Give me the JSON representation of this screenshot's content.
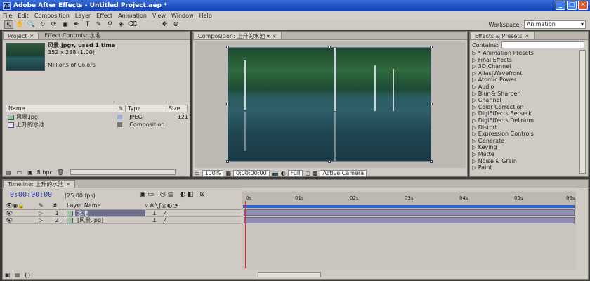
{
  "window": {
    "title": "Adobe After Effects - Untitled Project.aep *",
    "app_icon": "Ae",
    "controls": [
      "_",
      "□",
      "✕"
    ]
  },
  "menu": [
    "File",
    "Edit",
    "Composition",
    "Layer",
    "Effect",
    "Animation",
    "View",
    "Window",
    "Help"
  ],
  "toolbar": {
    "tools": [
      "↖",
      "✋",
      "🔍",
      "↻",
      "⟳",
      "▣",
      "✒",
      "T",
      "✎",
      "⚲",
      "◈",
      "⌫",
      "✥",
      "⊕"
    ],
    "workspace_label": "Workspace:",
    "workspace_value": "Animation"
  },
  "project": {
    "tabs": [
      "Project",
      "Effect Controls: 水池"
    ],
    "item_name": "风景.jpg▾, used 1 time",
    "item_dims": "352 x 288 (1.00)",
    "item_colors": "Millions of Colors",
    "columns": {
      "name": "Name",
      "type": "Type",
      "size": "Size"
    },
    "rows": [
      {
        "name": "风景.jpg",
        "type": "JPEG",
        "size": "121"
      },
      {
        "name": "上升的水池",
        "type": "Composition",
        "size": ""
      }
    ],
    "bpc": "8 bpc"
  },
  "composition": {
    "tab": "Composition: 上升的水池",
    "zoom": "100%",
    "timecode": "0:00:00:00",
    "resolution": "Full",
    "camera": "Active Camera"
  },
  "effects": {
    "tab": "Effects & Presets",
    "contains_label": "Contains:",
    "items": [
      "▷ * Animation Presets",
      "▷ Final Effects",
      "▷ 3D Channel",
      "▷ Alias|Wavefront",
      "▷ Atomic Power",
      "▷ Audio",
      "▷ Blur & Sharpen",
      "▷ Channel",
      "▷ Color Correction",
      "▷ DigiEffects Berserk",
      "▷ DigiEffects Delirium",
      "▷ Distort",
      "▷ Expression Controls",
      "▷ Generate",
      "▷ Keying",
      "▷ Matte",
      "▷ Noise & Grain",
      "▷ Paint"
    ]
  },
  "timeline": {
    "tab": "Timeline: 上升的水池",
    "timecode": "0:00:00:00",
    "fps": "(25.00 fps)",
    "layer_header": "Layer Name",
    "ruler": [
      "0s",
      "01s",
      "02s",
      "03s",
      "04s",
      "05s",
      "06s"
    ],
    "layers": [
      {
        "num": "1",
        "name": "水池"
      },
      {
        "num": "2",
        "name": "[风景.jpg]"
      }
    ]
  },
  "colors": {
    "title_bar": "#1e4fc4",
    "timecode": "#1b3fa8",
    "layer_bar": "#8f8eb0",
    "cti": "#e23"
  }
}
